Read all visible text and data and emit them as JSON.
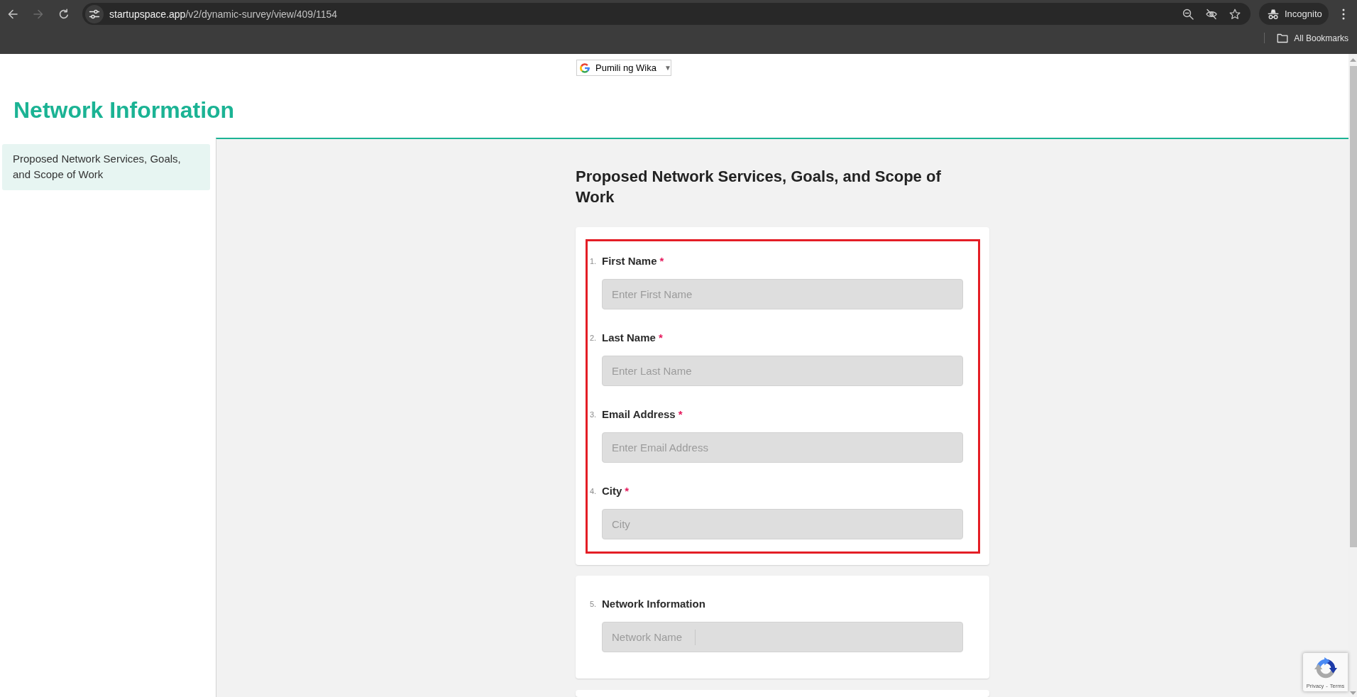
{
  "browser": {
    "nav_buttons": [
      {
        "kind": "back",
        "disabled": false
      },
      {
        "kind": "forward",
        "disabled": true
      },
      {
        "kind": "reload",
        "disabled": false
      }
    ],
    "address": {
      "domain": "startupspace.app",
      "path": "/v2/dynamic-survey/view/409/1154"
    },
    "profile_label": "Incognito",
    "bookmarks_label": "All Bookmarks"
  },
  "language_select": {
    "label": "Pumili ng Wika",
    "arrow": "▼"
  },
  "page_title": "Network Information",
  "sidebar": {
    "items": [
      {
        "label": "Proposed Network Services, Goals, and Scope of Work",
        "selected": true
      }
    ]
  },
  "form": {
    "title": "Proposed Network Services, Goals, and Scope of Work",
    "cards": [
      {
        "highlighted": true,
        "questions": [
          {
            "number": "1.",
            "label": "First Name",
            "required_mark": "*",
            "kind": "text",
            "placeholder": "Enter First Name"
          },
          {
            "number": "2.",
            "label": "Last Name",
            "required_mark": "*",
            "kind": "text",
            "placeholder": "Enter Last Name"
          },
          {
            "number": "3.",
            "label": "Email Address",
            "required_mark": "*",
            "kind": "text",
            "placeholder": "Enter Email Address"
          },
          {
            "number": "4.",
            "label": "City",
            "required_mark": "*",
            "kind": "text",
            "placeholder": "City"
          }
        ]
      },
      {
        "highlighted": false,
        "questions": [
          {
            "number": "5.",
            "label": "Network Information",
            "kind": "segmented",
            "placeholder": "Network Name"
          }
        ]
      },
      {
        "highlighted": false
      }
    ]
  },
  "recaptcha": {
    "links": [
      "Privacy",
      "Terms"
    ],
    "separator": "-"
  }
}
